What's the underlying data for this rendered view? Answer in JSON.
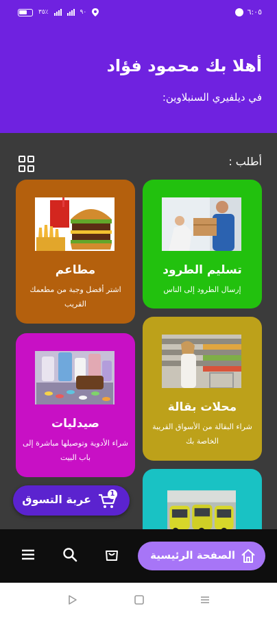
{
  "status_bar": {
    "left_text_1": "٣٥٪",
    "left_text_2": "٩٠",
    "time": "٦:٠٥"
  },
  "header": {
    "greeting": "أهلا بك محمود فؤاد",
    "subtitle": "في ديلفيري السنبلاوين:"
  },
  "main": {
    "order_label": "أطلب :",
    "cards": [
      {
        "title": "تسليم الطرود",
        "desc": "إرسال الطرود إلى الناس",
        "color": "#22c10e"
      },
      {
        "title": "مطاعم",
        "desc": "اشتر أفضل وجبة من مطعمك القريب",
        "color": "#b4600d"
      },
      {
        "title": "محلات بقالة",
        "desc": "شراء البقالة من الأسواق القريبة الخاصة بك",
        "color": "#bda11a"
      },
      {
        "title": "صيدليات",
        "desc": "شراء الأدوية وتوصيلها مباشرة إلى باب البيت",
        "color": "#c810c5"
      },
      {
        "title": "",
        "desc": "",
        "color": "#19c2c4"
      }
    ]
  },
  "cart": {
    "label": "عربة التسوق",
    "count": "1"
  },
  "bottom_nav": {
    "home_label": "الصفحة الرئيسية",
    "icons": [
      "home-icon",
      "bag-icon",
      "search-icon",
      "menu-icon"
    ]
  },
  "colors": {
    "primary": "#6f22e0",
    "dark_bg": "#3b3b3b",
    "nav_bg": "#0e0e0e",
    "home_pill": "#a775f7",
    "cart_pill": "#5b23cf"
  }
}
